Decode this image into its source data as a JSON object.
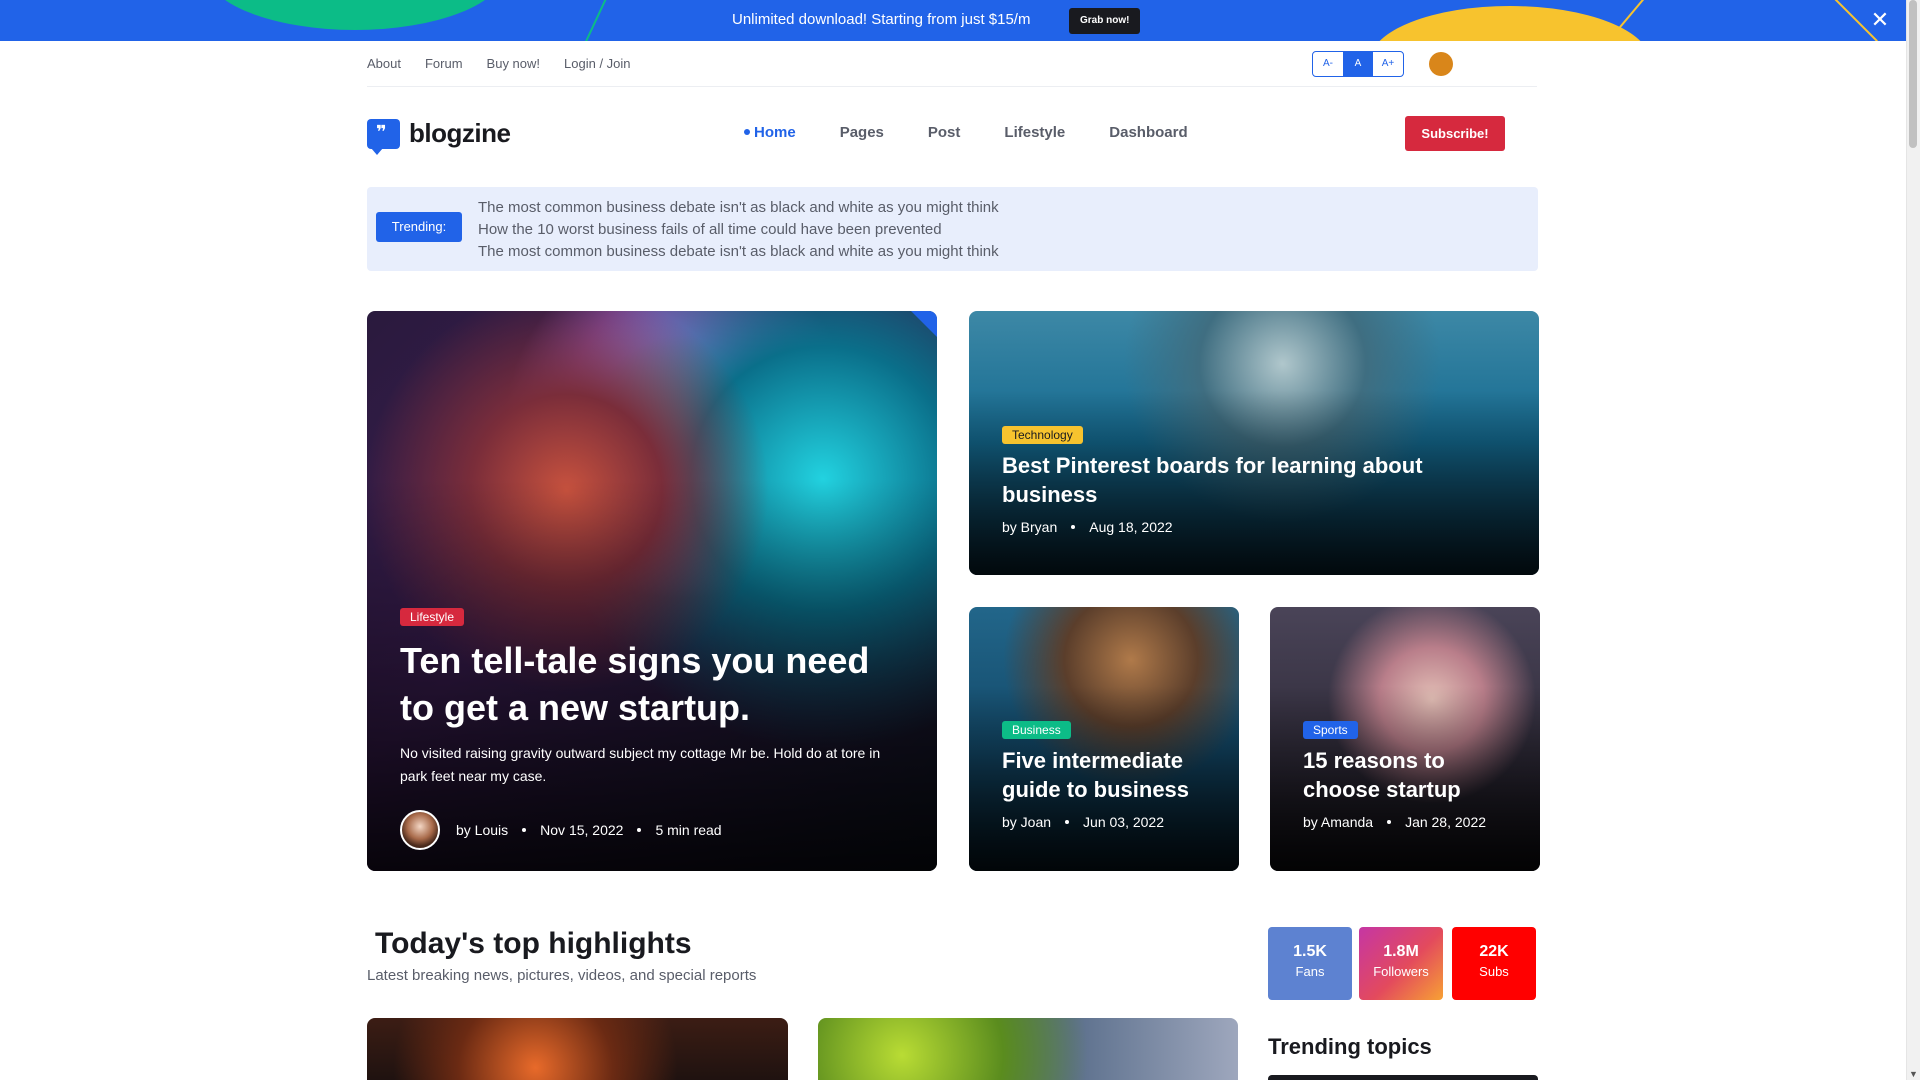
{
  "promo": {
    "text": "Unlimited download! Starting from just $15/m",
    "button": "Grab now!",
    "close_icon": "close-icon"
  },
  "toplinks": [
    "About",
    "Forum",
    "Buy now!",
    "Login / Join"
  ],
  "font_sizer": [
    "A-",
    "A",
    "A+"
  ],
  "header": {
    "logo_text": "blogzine",
    "logo_glyph": "❞",
    "nav": [
      "Home",
      "Pages",
      "Post",
      "Lifestyle",
      "Dashboard"
    ],
    "subscribe": "Subscribe!"
  },
  "trending": {
    "badge": "Trending:",
    "items": [
      "The most common business debate isn't as black and white as you might think",
      "How the 10 worst business fails of all time could have been prevented",
      "The most common business debate isn't as black and white as you might think"
    ]
  },
  "featured": {
    "main": {
      "category": "Lifestyle",
      "category_color": "#d6293e",
      "title": "Ten tell-tale signs you need to get a new startup.",
      "excerpt": "No visited raising gravity outward subject my cottage Mr be. Hold do at tore in park feet near my case.",
      "author": "by Louis",
      "date": "Nov 15, 2022",
      "read_time": "5 min read"
    },
    "tech": {
      "category": "Technology",
      "category_color": "#f7c32e",
      "title": "Best Pinterest boards for learning about business",
      "author": "by Bryan",
      "date": "Aug 18, 2022"
    },
    "business": {
      "category": "Business",
      "category_color": "#0cbc87",
      "title": "Five intermediate guide to business",
      "author": "by Joan",
      "date": "Jun 03, 2022"
    },
    "sports": {
      "category": "Sports",
      "category_color": "#2163e8",
      "title": "15 reasons to choose startup",
      "author": "by Amanda",
      "date": "Jan 28, 2022"
    }
  },
  "highlights": {
    "title": "Today's top highlights",
    "subtitle": "Latest breaking news, pictures, videos, and special reports"
  },
  "social": [
    {
      "num": "1.5K",
      "label": "Fans"
    },
    {
      "num": "1.8M",
      "label": "Followers"
    },
    {
      "num": "22K",
      "label": "Subs"
    }
  ],
  "sidebar": {
    "trending_title": "Trending topics"
  },
  "colors": {
    "primary": "#2163e8",
    "danger": "#d6293e",
    "success": "#0cbc87",
    "warning": "#f7c32e"
  }
}
